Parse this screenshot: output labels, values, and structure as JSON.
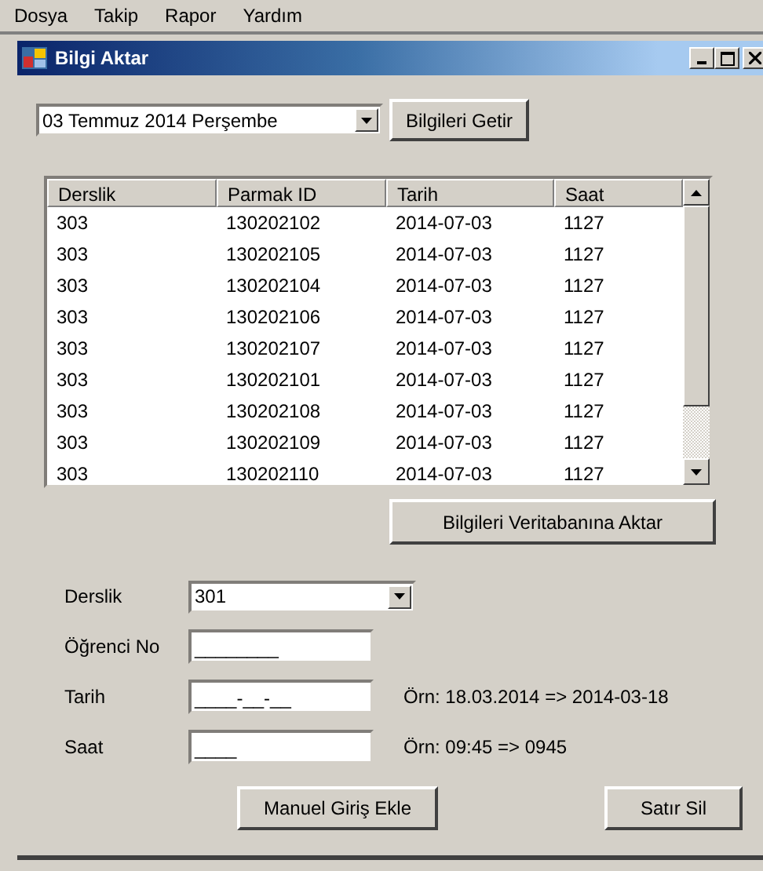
{
  "menu": [
    "Dosya",
    "Takip",
    "Rapor",
    "Yardım"
  ],
  "window": {
    "title": "Bilgi Aktar"
  },
  "date_picker": {
    "value": "03 Temmuz 2014 Perşembe"
  },
  "fetch_button": "Bilgileri Getir",
  "table": {
    "columns": [
      "Derslik",
      "Parmak ID",
      "Tarih",
      "Saat"
    ],
    "rows": [
      [
        "303",
        "130202102",
        "2014-07-03",
        "1127"
      ],
      [
        "303",
        "130202105",
        "2014-07-03",
        "1127"
      ],
      [
        "303",
        "130202104",
        "2014-07-03",
        "1127"
      ],
      [
        "303",
        "130202106",
        "2014-07-03",
        "1127"
      ],
      [
        "303",
        "130202107",
        "2014-07-03",
        "1127"
      ],
      [
        "303",
        "130202101",
        "2014-07-03",
        "1127"
      ],
      [
        "303",
        "130202108",
        "2014-07-03",
        "1127"
      ],
      [
        "303",
        "130202109",
        "2014-07-03",
        "1127"
      ],
      [
        "303",
        "130202110",
        "2014-07-03",
        "1127"
      ]
    ]
  },
  "transfer_button": "Bilgileri Veritabanına Aktar",
  "form": {
    "fields": [
      {
        "label": "Derslik",
        "kind": "combo",
        "value": "301"
      },
      {
        "label": "Öğrenci No",
        "kind": "masked",
        "value": "________"
      },
      {
        "label": "Tarih",
        "kind": "masked",
        "value": "____-__-__",
        "hint": "Örn: 18.03.2014 => 2014-03-18"
      },
      {
        "label": "Saat",
        "kind": "masked",
        "value": "____",
        "hint": "Örn: 09:45 => 0945"
      }
    ]
  },
  "buttons": {
    "add": "Manuel Giriş Ekle",
    "delete": "Satır Sil"
  }
}
